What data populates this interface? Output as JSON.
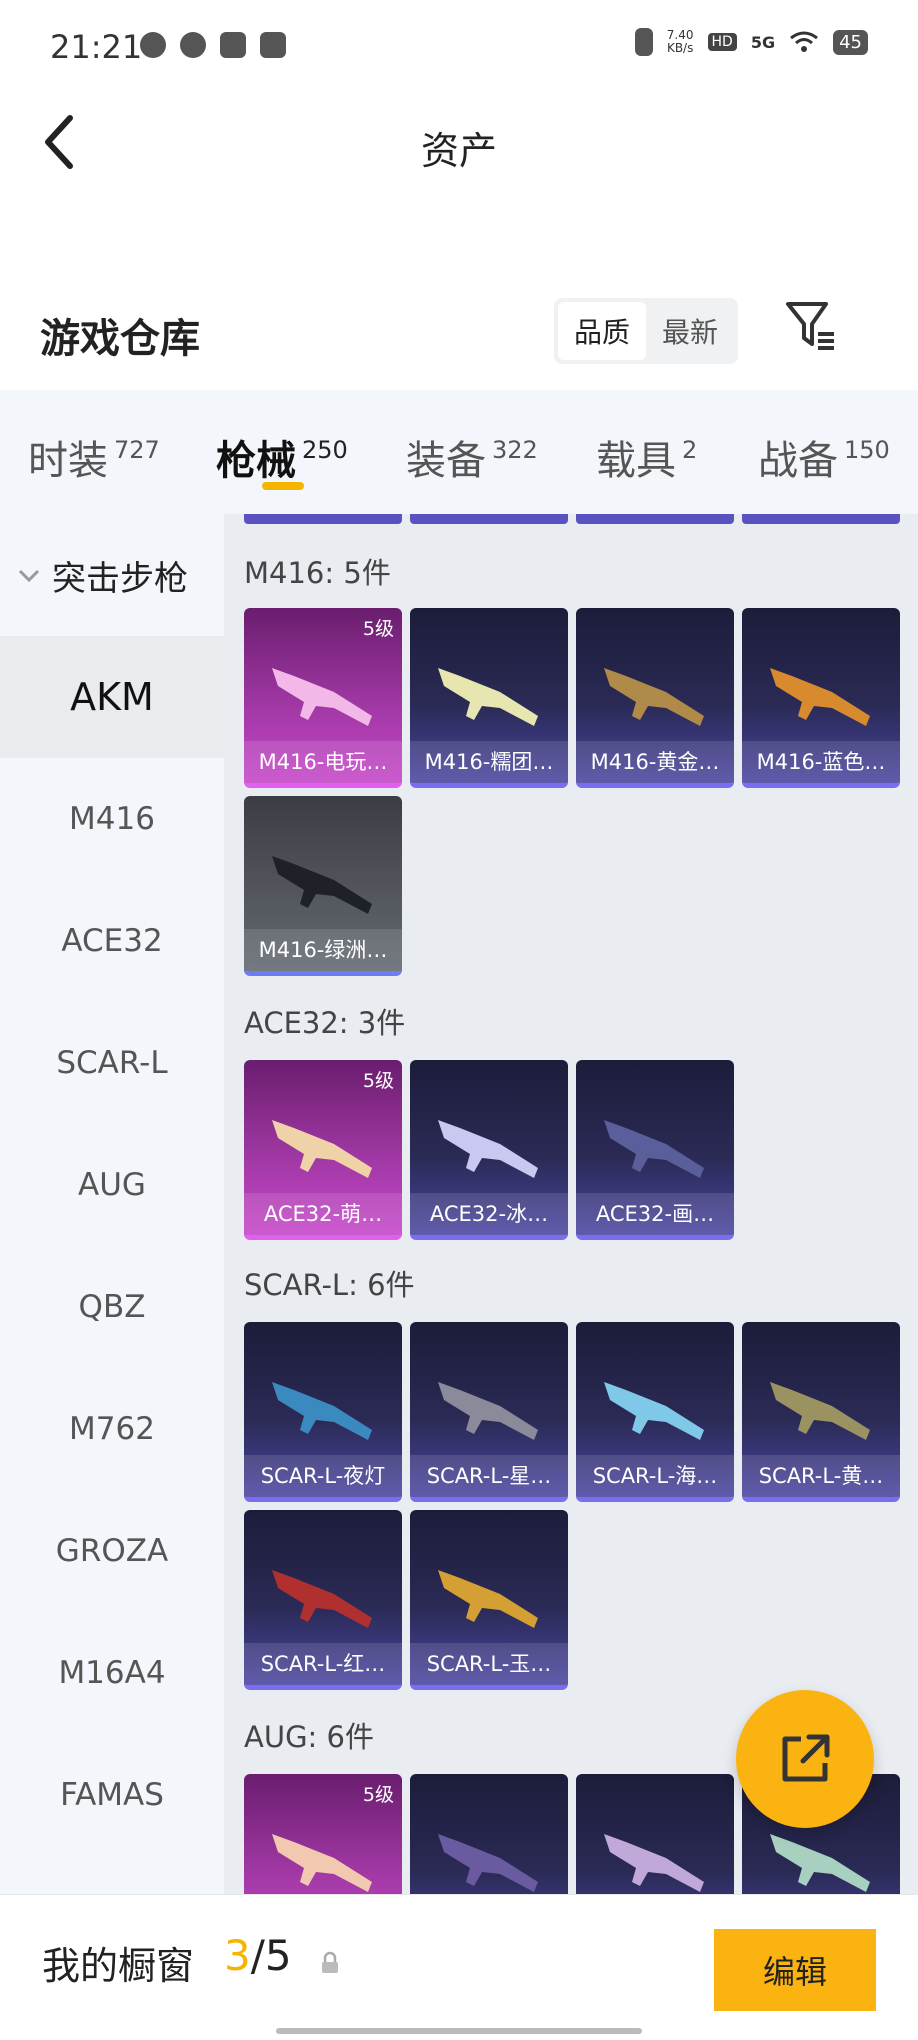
{
  "status_bar": {
    "time": "21:21",
    "speed_value": "7.40",
    "speed_unit": "KB/s",
    "hd": "HD",
    "network": "5G",
    "battery": "45"
  },
  "header": {
    "title": "资产"
  },
  "warehouse": {
    "title": "游戏仓库",
    "sort_options": [
      "品质",
      "最新"
    ],
    "selected_sort": "品质"
  },
  "tabs": [
    {
      "label": "时装",
      "count": "727"
    },
    {
      "label": "枪械",
      "count": "250"
    },
    {
      "label": "装备",
      "count": "322"
    },
    {
      "label": "载具",
      "count": "2"
    },
    {
      "label": "战备",
      "count": "150"
    }
  ],
  "sidebar": {
    "group": "突击步枪",
    "items": [
      "AKM",
      "M416",
      "ACE32",
      "SCAR-L",
      "AUG",
      "QBZ",
      "M762",
      "GROZA",
      "M16A4",
      "FAMAS"
    ],
    "selected": "AKM"
  },
  "sections": [
    {
      "title": "M416: 5件",
      "items": [
        {
          "name": "M416-电玩…",
          "grade": "5级"
        },
        {
          "name": "M416-糯团…"
        },
        {
          "name": "M416-黄金…"
        },
        {
          "name": "M416-蓝色…"
        },
        {
          "name": "M416-绿洲…"
        }
      ]
    },
    {
      "title": "ACE32: 3件",
      "items": [
        {
          "name": "ACE32-萌…",
          "grade": "5级"
        },
        {
          "name": "ACE32-冰…"
        },
        {
          "name": "ACE32-画…"
        }
      ]
    },
    {
      "title": "SCAR-L: 6件",
      "items": [
        {
          "name": "SCAR-L-夜灯"
        },
        {
          "name": "SCAR-L-星…"
        },
        {
          "name": "SCAR-L-海…"
        },
        {
          "name": "SCAR-L-黄…"
        },
        {
          "name": "SCAR-L-红…"
        },
        {
          "name": "SCAR-L-玉…"
        }
      ]
    },
    {
      "title": "AUG: 6件",
      "items": [
        {
          "name": "",
          "grade": "5级"
        }
      ]
    }
  ],
  "bottom_bar": {
    "label": "我的橱窗",
    "current": "3",
    "separator": "/",
    "total": "5",
    "edit_label": "编辑"
  },
  "colors": {
    "accent": "#fbb312",
    "card_purple": "#2a2a55",
    "card_pink": "#a43aa8",
    "card_gray": "#55585f"
  }
}
